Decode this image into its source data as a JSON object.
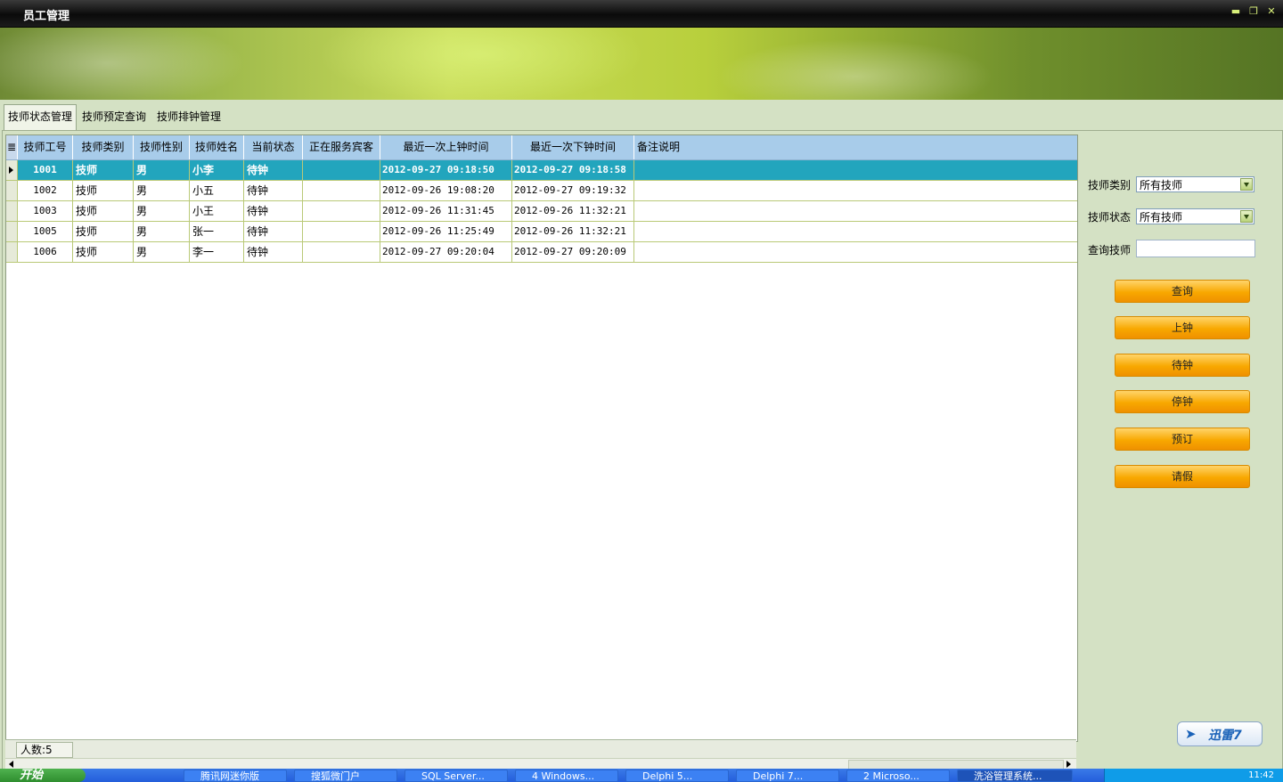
{
  "window": {
    "title": "员工管理",
    "controls": [
      "▬",
      "❐",
      "✕"
    ]
  },
  "tabs": [
    {
      "label": "技师状态管理"
    },
    {
      "label": "技师预定查询"
    },
    {
      "label": "技师排钟管理"
    }
  ],
  "grid": {
    "columns": [
      "技师工号",
      "技师类别",
      "技师性别",
      "技师姓名",
      "当前状态",
      "正在服务宾客",
      "最近一次上钟时间",
      "最近一次下钟时间",
      "备注说明"
    ],
    "rows": [
      {
        "id": "1001",
        "type": "技师",
        "gender": "男",
        "name": "小李",
        "status": "待钟",
        "guest": "",
        "last_on": "2012-09-27 09:18:50",
        "last_off": "2012-09-27 09:18:58",
        "note": ""
      },
      {
        "id": "1002",
        "type": "技师",
        "gender": "男",
        "name": "小五",
        "status": "待钟",
        "guest": "",
        "last_on": "2012-09-26 19:08:20",
        "last_off": "2012-09-27 09:19:32",
        "note": ""
      },
      {
        "id": "1003",
        "type": "技师",
        "gender": "男",
        "name": "小王",
        "status": "待钟",
        "guest": "",
        "last_on": "2012-09-26 11:31:45",
        "last_off": "2012-09-26 11:32:21",
        "note": ""
      },
      {
        "id": "1005",
        "type": "技师",
        "gender": "男",
        "name": "张一",
        "status": "待钟",
        "guest": "",
        "last_on": "2012-09-26 11:25:49",
        "last_off": "2012-09-26 11:32:21",
        "note": ""
      },
      {
        "id": "1006",
        "type": "技师",
        "gender": "男",
        "name": "李一",
        "status": "待钟",
        "guest": "",
        "last_on": "2012-09-27 09:20:04",
        "last_off": "2012-09-27 09:20:09",
        "note": ""
      }
    ],
    "count_label": "人数:5"
  },
  "filters": {
    "type_label": "技师类别",
    "type_value": "所有技师",
    "status_label": "技师状态",
    "status_value": "所有技师",
    "search_label": "查询技师",
    "search_value": ""
  },
  "actions": {
    "query": "查询",
    "on_duty": "上钟",
    "waiting": "待钟",
    "stop": "停钟",
    "reserve": "预订",
    "leave": "请假"
  },
  "logo_text": "迅雷7",
  "taskbar": {
    "start": "开始",
    "tasks": [
      "腾讯网迷你版",
      "搜狐微门户",
      "SQL Server...",
      "4 Windows...",
      "Delphi 5...",
      "Delphi 7...",
      "2 Microso...",
      "洗浴管理系统..."
    ],
    "clock": "11:42"
  },
  "colors": {
    "selected_row": "#22a5bd",
    "header": "#a8ccea",
    "button": "#f8a800"
  }
}
